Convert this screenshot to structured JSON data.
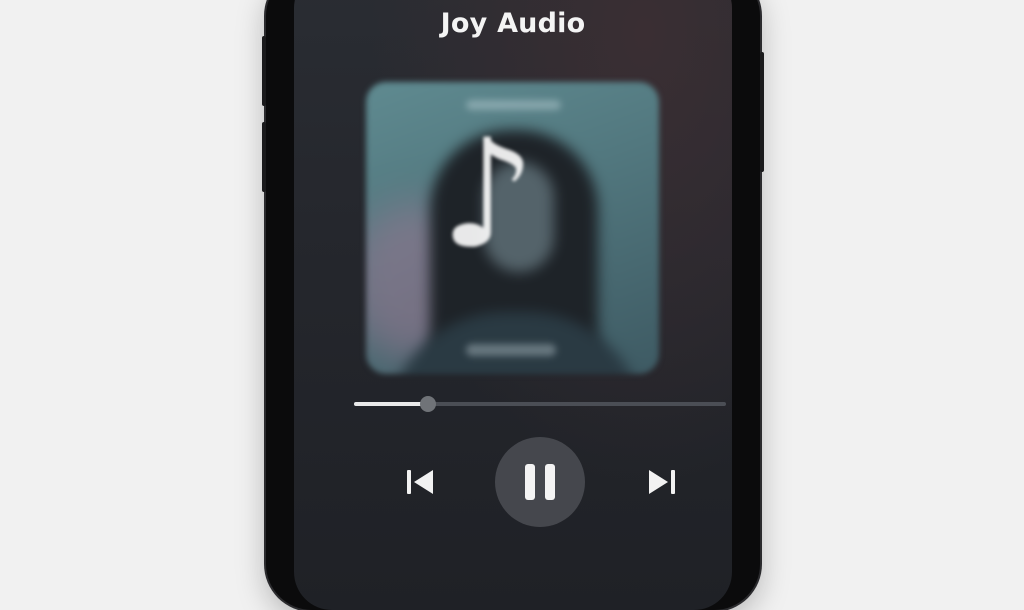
{
  "player": {
    "title": "Joy Audio",
    "album_art_icon": "music-note-icon",
    "progress": 0.2,
    "controls": {
      "previous_icon": "skip-previous-icon",
      "play_pause_icon": "pause-icon",
      "next_icon": "skip-next-icon"
    }
  },
  "colors": {
    "background": "#f1f1f1",
    "phone_frame": "#0b0b0c",
    "screen": "#25272d",
    "accent": "#e9e9ea"
  }
}
